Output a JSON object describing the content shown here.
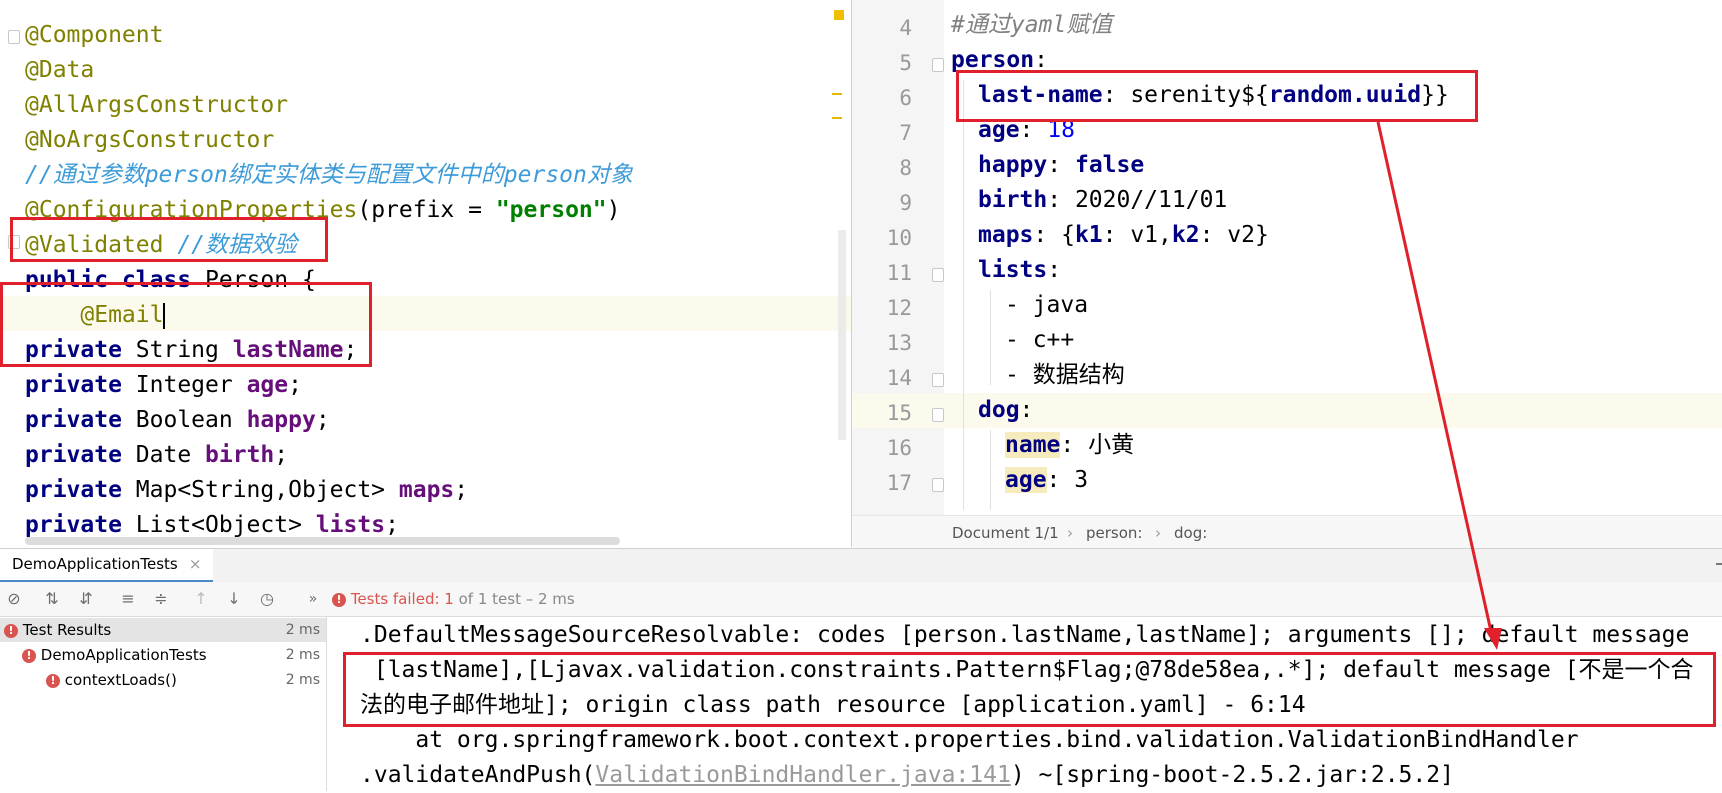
{
  "left_code": {
    "l1": "@Component",
    "l2": "@Data",
    "l3": "@AllArgsConstructor",
    "l4": "@NoArgsConstructor",
    "l5_comment": "//通过参数person绑定实体类与配置文件中的person对象",
    "l6_ann": "@ConfigurationProperties",
    "l6_open": "(prefix = ",
    "l6_str": "\"person\"",
    "l6_close": ")",
    "l7_ann": "@Validated",
    "l7_comment": " //数据效验",
    "l8_public": "public",
    "l8_class": " class",
    "l8_rest": " Person {",
    "l9": "    @Email",
    "l10_kw": "private",
    "l10_type": " String ",
    "l10_field": "lastName",
    "l10_end": ";",
    "l11_kw": "private",
    "l11_type": " Integer ",
    "l11_field": "age",
    "l11_end": ";",
    "l12_kw": "private",
    "l12_type": " Boolean ",
    "l12_field": "happy",
    "l12_end": ";",
    "l13_kw": "private",
    "l13_type": " Date ",
    "l13_field": "birth",
    "l13_end": ";",
    "l14_kw": "private",
    "l14_type": " Map<String,Object> ",
    "l14_field": "maps",
    "l14_end": ";",
    "l15_kw": "private",
    "l15_type": " List<Object> ",
    "l15_field": "lists",
    "l15_end": ";"
  },
  "yaml": {
    "line_numbers": [
      "4",
      "5",
      "6",
      "7",
      "8",
      "9",
      "10",
      "11",
      "12",
      "13",
      "14",
      "15",
      "16",
      "17"
    ],
    "l4_comment": "#通过yaml赋值",
    "l5_key": "person",
    "l6_key": "last-name",
    "l6_val_a": ": serenity${",
    "l6_val_b": "random.uuid",
    "l6_val_c": "}}",
    "l7_key": "age",
    "l7_val": "18",
    "l8_key": "happy",
    "l8_val": "false",
    "l9_key": "birth",
    "l9_val": ": 2020//11/01",
    "l10_key": "maps",
    "l10_a": ": {",
    "l10_k1": "k1",
    "l10_b": ": v1,",
    "l10_k2": "k2",
    "l10_c": ": v2}",
    "l11_key": "lists",
    "l12": "- java",
    "l13": "- c++",
    "l14": "- 数据结构",
    "l15_key": "dog",
    "l16_key": "name",
    "l16_val": ": 小黄",
    "l17_key": "age",
    "l17_val": ": 3",
    "colon": ":"
  },
  "status_bar": {
    "document": "Document 1/1",
    "crumb1": "person:",
    "crumb2": "dog:",
    "sep": "›"
  },
  "panel": {
    "tab_label": "DemoApplicationTests",
    "tab_close": "×",
    "expand_marker": "»",
    "tests_failed_label": "Tests failed: ",
    "tests_failed_count": "1",
    "tests_failed_rest": " of 1 test – 2 ms",
    "tree": [
      {
        "label": "Test Results",
        "duration": "2 ms"
      },
      {
        "label": "DemoApplicationTests",
        "duration": "2 ms"
      },
      {
        "label": "contextLoads()",
        "duration": "2 ms"
      }
    ]
  },
  "console": {
    "line1": ".DefaultMessageSourceResolvable: codes [person.lastName,lastName]; arguments []; default message",
    "line2": " [lastName],[Ljavax.validation.constraints.Pattern$Flag;@78de58ea,.*]; default message [不是一个合",
    "line3": "法的电子邮件地址]; origin class path resource [application.yaml] - 6:14",
    "line4": "    at org.springframework.boot.context.properties.bind.validation.ValidationBindHandler",
    "line5_a": ".validateAndPush(",
    "line5_link": "ValidationBindHandler.java:141",
    "line5_b": ") ~[spring-boot-2.5.2.jar:2.5.2]"
  },
  "colors": {
    "annotation_red": "#e0202a",
    "keyword": "#000080",
    "annotation": "#808000",
    "comment": "#3d9bd8",
    "field": "#660e7a",
    "error": "#d9534f"
  }
}
